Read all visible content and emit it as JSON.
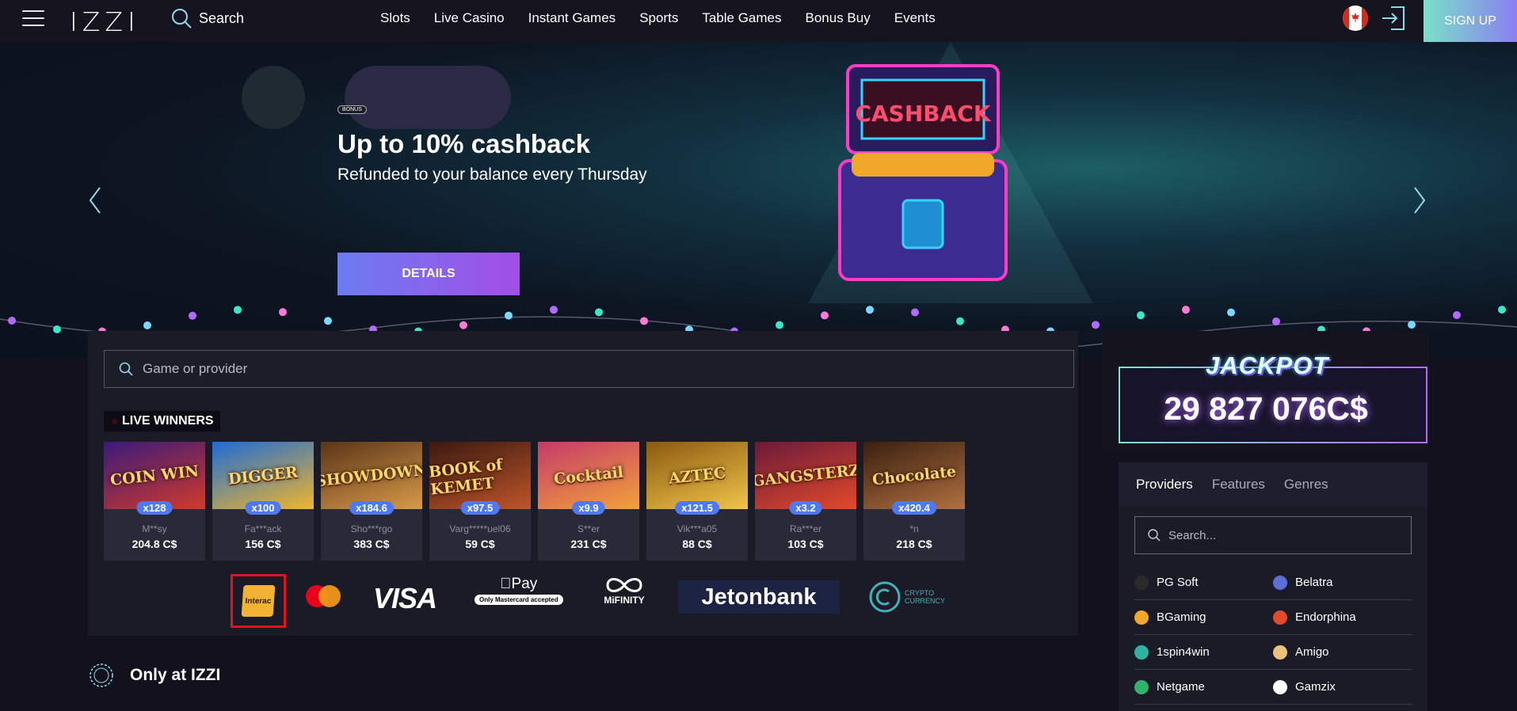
{
  "header": {
    "logo": "IZZI",
    "search_label": "Search",
    "nav": [
      "Slots",
      "Live Casino",
      "Instant Games",
      "Sports",
      "Table Games",
      "Bonus Buy",
      "Events"
    ],
    "signup": "SIGN UP"
  },
  "hero": {
    "badge": "BONUS",
    "title": "Up to 10% cashback",
    "subtitle": "Refunded to your balance every Thursday",
    "button": "DETAILS",
    "chest_text": "CASHBACK"
  },
  "main": {
    "search_placeholder": "Game or provider",
    "live_winners_label": "LIVE WINNERS",
    "winners": [
      {
        "game": "COIN WIN",
        "multiplier": "x128",
        "user": "M**sy",
        "amount": "204.8 C$",
        "colors": [
          "#3a1a7a",
          "#d13a2a"
        ]
      },
      {
        "game": "DIGGER",
        "multiplier": "x100",
        "user": "Fa***ack",
        "amount": "156 C$",
        "colors": [
          "#1d6bd8",
          "#f0b62a"
        ]
      },
      {
        "game": "SHOWDOWN",
        "multiplier": "x184.6",
        "user": "Sho***rgo",
        "amount": "383 C$",
        "colors": [
          "#5a3518",
          "#d89a4a"
        ]
      },
      {
        "game": "BOOK of KEMET",
        "multiplier": "x97.5",
        "user": "Varg*****uel06",
        "amount": "59 C$",
        "colors": [
          "#3a1a10",
          "#c0552a"
        ]
      },
      {
        "game": "Cocktail",
        "multiplier": "x9.9",
        "user": "S**er",
        "amount": "231 C$",
        "colors": [
          "#c53a6a",
          "#f2a23a"
        ]
      },
      {
        "game": "AZTEC",
        "multiplier": "x121.5",
        "user": "Vik***a05",
        "amount": "88 C$",
        "colors": [
          "#8a5a10",
          "#f1c44a"
        ]
      },
      {
        "game": "GANGSTERZ",
        "multiplier": "x3.2",
        "user": "Ra***er",
        "amount": "103 C$",
        "colors": [
          "#6a1a3a",
          "#e24a2a"
        ]
      },
      {
        "game": "Chocolate",
        "multiplier": "x420.4",
        "user": "*n",
        "amount": "218 C$",
        "colors": [
          "#3a2010",
          "#b07040"
        ]
      }
    ],
    "payments": {
      "interac": "Interac",
      "visa": "VISA",
      "apple_pay": "Pay",
      "apple_pay_note": "Only Mastercard accepted",
      "mifinity": "MiFINITY",
      "jetonbank": "Jetonbank",
      "crypto": "CRYPTO",
      "crypto2": "CURRENCY"
    },
    "only_label": "Only at IZZI"
  },
  "jackpot": {
    "title": "JACKPOT",
    "amount": "29 827 076C$"
  },
  "sidebar": {
    "tabs": [
      "Providers",
      "Features",
      "Genres"
    ],
    "search_placeholder": "Search...",
    "providers": [
      {
        "name": "PG Soft",
        "color": "#2a2a2a"
      },
      {
        "name": "Belatra",
        "color": "#5a6fd8"
      },
      {
        "name": "BGaming",
        "color": "#f0a82a"
      },
      {
        "name": "Endorphina",
        "color": "#e24a2a"
      },
      {
        "name": "1spin4win",
        "color": "#2fb3a0"
      },
      {
        "name": "Amigo",
        "color": "#e8c27a"
      },
      {
        "name": "Netgame",
        "color": "#2fb36a"
      },
      {
        "name": "Gamzix",
        "color": "#ffffff"
      }
    ]
  }
}
